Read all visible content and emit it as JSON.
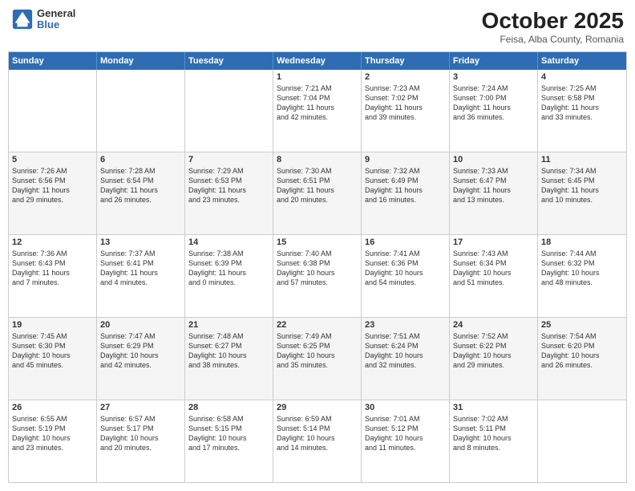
{
  "header": {
    "logo_line1": "General",
    "logo_line2": "Blue",
    "title": "October 2025",
    "subtitle": "Feisa, Alba County, Romania"
  },
  "days_of_week": [
    "Sunday",
    "Monday",
    "Tuesday",
    "Wednesday",
    "Thursday",
    "Friday",
    "Saturday"
  ],
  "rows": [
    {
      "alt": false,
      "cells": [
        {
          "day": "",
          "text": ""
        },
        {
          "day": "",
          "text": ""
        },
        {
          "day": "",
          "text": ""
        },
        {
          "day": "1",
          "text": "Sunrise: 7:21 AM\nSunset: 7:04 PM\nDaylight: 11 hours\nand 42 minutes."
        },
        {
          "day": "2",
          "text": "Sunrise: 7:23 AM\nSunset: 7:02 PM\nDaylight: 11 hours\nand 39 minutes."
        },
        {
          "day": "3",
          "text": "Sunrise: 7:24 AM\nSunset: 7:00 PM\nDaylight: 11 hours\nand 36 minutes."
        },
        {
          "day": "4",
          "text": "Sunrise: 7:25 AM\nSunset: 6:58 PM\nDaylight: 11 hours\nand 33 minutes."
        }
      ]
    },
    {
      "alt": true,
      "cells": [
        {
          "day": "5",
          "text": "Sunrise: 7:26 AM\nSunset: 6:56 PM\nDaylight: 11 hours\nand 29 minutes."
        },
        {
          "day": "6",
          "text": "Sunrise: 7:28 AM\nSunset: 6:54 PM\nDaylight: 11 hours\nand 26 minutes."
        },
        {
          "day": "7",
          "text": "Sunrise: 7:29 AM\nSunset: 6:53 PM\nDaylight: 11 hours\nand 23 minutes."
        },
        {
          "day": "8",
          "text": "Sunrise: 7:30 AM\nSunset: 6:51 PM\nDaylight: 11 hours\nand 20 minutes."
        },
        {
          "day": "9",
          "text": "Sunrise: 7:32 AM\nSunset: 6:49 PM\nDaylight: 11 hours\nand 16 minutes."
        },
        {
          "day": "10",
          "text": "Sunrise: 7:33 AM\nSunset: 6:47 PM\nDaylight: 11 hours\nand 13 minutes."
        },
        {
          "day": "11",
          "text": "Sunrise: 7:34 AM\nSunset: 6:45 PM\nDaylight: 11 hours\nand 10 minutes."
        }
      ]
    },
    {
      "alt": false,
      "cells": [
        {
          "day": "12",
          "text": "Sunrise: 7:36 AM\nSunset: 6:43 PM\nDaylight: 11 hours\nand 7 minutes."
        },
        {
          "day": "13",
          "text": "Sunrise: 7:37 AM\nSunset: 6:41 PM\nDaylight: 11 hours\nand 4 minutes."
        },
        {
          "day": "14",
          "text": "Sunrise: 7:38 AM\nSunset: 6:39 PM\nDaylight: 11 hours\nand 0 minutes."
        },
        {
          "day": "15",
          "text": "Sunrise: 7:40 AM\nSunset: 6:38 PM\nDaylight: 10 hours\nand 57 minutes."
        },
        {
          "day": "16",
          "text": "Sunrise: 7:41 AM\nSunset: 6:36 PM\nDaylight: 10 hours\nand 54 minutes."
        },
        {
          "day": "17",
          "text": "Sunrise: 7:43 AM\nSunset: 6:34 PM\nDaylight: 10 hours\nand 51 minutes."
        },
        {
          "day": "18",
          "text": "Sunrise: 7:44 AM\nSunset: 6:32 PM\nDaylight: 10 hours\nand 48 minutes."
        }
      ]
    },
    {
      "alt": true,
      "cells": [
        {
          "day": "19",
          "text": "Sunrise: 7:45 AM\nSunset: 6:30 PM\nDaylight: 10 hours\nand 45 minutes."
        },
        {
          "day": "20",
          "text": "Sunrise: 7:47 AM\nSunset: 6:29 PM\nDaylight: 10 hours\nand 42 minutes."
        },
        {
          "day": "21",
          "text": "Sunrise: 7:48 AM\nSunset: 6:27 PM\nDaylight: 10 hours\nand 38 minutes."
        },
        {
          "day": "22",
          "text": "Sunrise: 7:49 AM\nSunset: 6:25 PM\nDaylight: 10 hours\nand 35 minutes."
        },
        {
          "day": "23",
          "text": "Sunrise: 7:51 AM\nSunset: 6:24 PM\nDaylight: 10 hours\nand 32 minutes."
        },
        {
          "day": "24",
          "text": "Sunrise: 7:52 AM\nSunset: 6:22 PM\nDaylight: 10 hours\nand 29 minutes."
        },
        {
          "day": "25",
          "text": "Sunrise: 7:54 AM\nSunset: 6:20 PM\nDaylight: 10 hours\nand 26 minutes."
        }
      ]
    },
    {
      "alt": false,
      "cells": [
        {
          "day": "26",
          "text": "Sunrise: 6:55 AM\nSunset: 5:19 PM\nDaylight: 10 hours\nand 23 minutes."
        },
        {
          "day": "27",
          "text": "Sunrise: 6:57 AM\nSunset: 5:17 PM\nDaylight: 10 hours\nand 20 minutes."
        },
        {
          "day": "28",
          "text": "Sunrise: 6:58 AM\nSunset: 5:15 PM\nDaylight: 10 hours\nand 17 minutes."
        },
        {
          "day": "29",
          "text": "Sunrise: 6:59 AM\nSunset: 5:14 PM\nDaylight: 10 hours\nand 14 minutes."
        },
        {
          "day": "30",
          "text": "Sunrise: 7:01 AM\nSunset: 5:12 PM\nDaylight: 10 hours\nand 11 minutes."
        },
        {
          "day": "31",
          "text": "Sunrise: 7:02 AM\nSunset: 5:11 PM\nDaylight: 10 hours\nand 8 minutes."
        },
        {
          "day": "",
          "text": ""
        }
      ]
    }
  ]
}
